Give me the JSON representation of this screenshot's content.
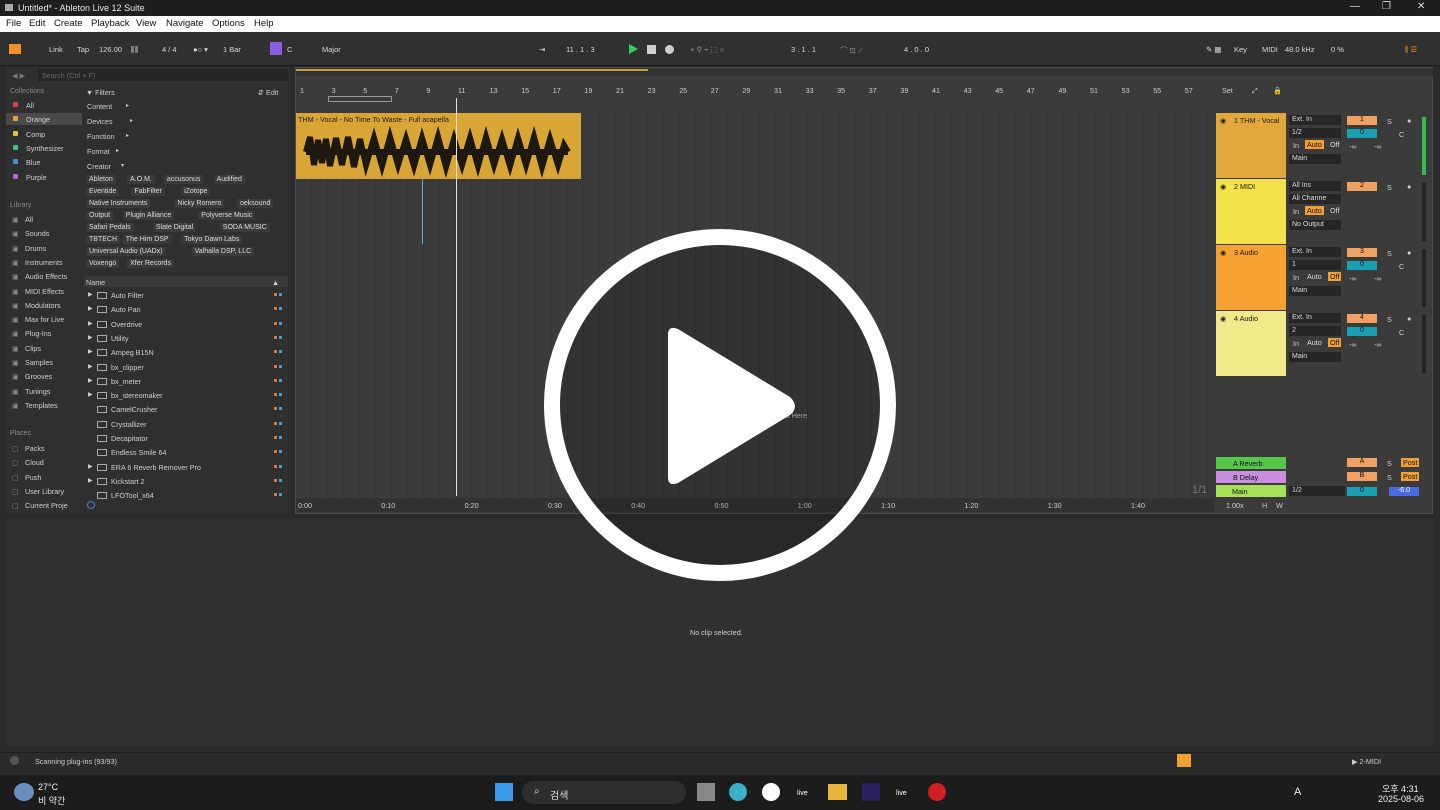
{
  "window": {
    "title": "Untitled* - Ableton Live 12 Suite"
  },
  "menu": [
    "File",
    "Edit",
    "Create",
    "Playback",
    "View",
    "Navigate",
    "Options",
    "Help"
  ],
  "transport": {
    "link": "Link",
    "tap": "Tap",
    "tempo": "126.00",
    "time_sig": "4 / 4",
    "quant": "1 Bar",
    "key": "C",
    "scale": "Major",
    "position": "11 .  1 .  3",
    "loop_start": "3 .  1 .  1",
    "loop_len": "4 .  0 .  0",
    "key_btn": "Key",
    "midi_btn": "MIDI",
    "sample_rate": "48.0 kHz",
    "cpu": "0 %"
  },
  "browser": {
    "search_placeholder": "Search (Ctrl + F)",
    "collections_title": "Collections",
    "collections": [
      {
        "label": "All",
        "color": "#e04040"
      },
      {
        "label": "Orange",
        "color": "#f0a030"
      },
      {
        "label": "Comp",
        "color": "#e8c040"
      },
      {
        "label": "Synthesizer",
        "color": "#40c080"
      },
      {
        "label": "Blue",
        "color": "#4090e0"
      },
      {
        "label": "Purple",
        "color": "#c060e0"
      }
    ],
    "library_title": "Library",
    "library": [
      "All",
      "Sounds",
      "Drums",
      "Instruments",
      "Audio Effects",
      "MIDI Effects",
      "Modulators",
      "Max for Live",
      "Plug-Ins",
      "Clips",
      "Samples",
      "Grooves",
      "Tunings",
      "Templates"
    ],
    "places_title": "Places",
    "places": [
      "Packs",
      "Cloud",
      "Push",
      "User Library",
      "Current Proje"
    ],
    "filters_label": "Filters",
    "edit_label": "Edit",
    "filter_groups": [
      "Content",
      "Devices",
      "Function",
      "Format",
      "Creator"
    ],
    "creators": [
      "Ableton",
      "A.O.M.",
      "accusonus",
      "Audified",
      "Eventide",
      "FabFilter",
      "iZotope",
      "Native Instruments",
      "Nicky Romero",
      "oeksound",
      "Output",
      "Plugin Alliance",
      "Polyverse Music",
      "Safari Pedals",
      "Slate Digital",
      "SODA MUSIC",
      "TBTECH",
      "The Him DSP",
      "Tokyo Dawn Labs",
      "Universal Audio (UADx)",
      "Valhalla DSP, LLC",
      "Voxengo",
      "Xfer Records"
    ],
    "name_header": "Name",
    "items": [
      "Auto Filter",
      "Auto Pan",
      "Overdrive",
      "Utility",
      "Ampeg B15N",
      "bx_clipper",
      "bx_meter",
      "bx_stereomaker",
      "CamelCrusher",
      "Crystallizer",
      "Decapitator",
      "Endless Smile 64",
      "ERA 6 Reverb Remover Pro",
      "Kickstart 2",
      "LFOTool_x64"
    ]
  },
  "ruler": [
    "1",
    "3",
    "5",
    "7",
    "9",
    "11",
    "13",
    "15",
    "17",
    "19",
    "21",
    "23",
    "25",
    "27",
    "29",
    "31",
    "33",
    "35",
    "37",
    "39",
    "41",
    "43",
    "45",
    "47",
    "49",
    "51",
    "53",
    "55",
    "57"
  ],
  "time_ruler": [
    "0:00",
    "0:10",
    "0:20",
    "0:30",
    "0:40",
    "0:50",
    "1:00",
    "1:10",
    "1:20",
    "1:30",
    "1:40"
  ],
  "set_label": "Set",
  "clip": {
    "name": "THM - Vocal - No Time To Waste - Full acapella"
  },
  "drop_text": "s Here",
  "tracks": [
    {
      "name": "1 THM - Vocal",
      "color": "#e2a93a",
      "in": "Ext. In",
      "ch": "1/2",
      "out": "Main",
      "num": "1",
      "vol": "0",
      "pan": "C"
    },
    {
      "name": "2 MIDI",
      "color": "#f4e24a",
      "in": "All Ins",
      "ch": "All Channe",
      "out": "No Output",
      "num": "2",
      "vol": "",
      "pan": ""
    },
    {
      "name": "3 Audio",
      "color": "#f5a233",
      "in": "Ext. In",
      "ch": "1",
      "out": "Main",
      "num": "3",
      "vol": "0",
      "pan": "C"
    },
    {
      "name": "4 Audio",
      "color": "#f2e98a",
      "in": "Ext. In",
      "ch": "2",
      "out": "Main",
      "num": "4",
      "vol": "0",
      "pan": "C"
    }
  ],
  "returns": [
    {
      "name": "A Reverb",
      "letter": "A",
      "post": "Post",
      "color": "#55c84a"
    },
    {
      "name": "B Delay",
      "letter": "B",
      "post": "Post",
      "color": "#c98ee0"
    }
  ],
  "main": {
    "name": "Main",
    "ch": "1/2",
    "vol": "0",
    "vol2": "-6.0",
    "color": "#a8e05a"
  },
  "mon": {
    "in": "In",
    "auto": "Auto",
    "off": "Off",
    "inf": "-∞",
    "s": "S",
    "hw": "H",
    "w": "W",
    "zoom": "1.00x",
    "page": "1/1"
  },
  "detail": {
    "message": "No clip selected."
  },
  "status": {
    "text": "Scanning plug-ins (93/93)",
    "track": "2-MIDI"
  },
  "taskbar": {
    "temp": "27°C",
    "weather": "비 약간",
    "search": "검색",
    "time": "오후 4:31",
    "date": "2025-08-06",
    "lang": "A"
  }
}
